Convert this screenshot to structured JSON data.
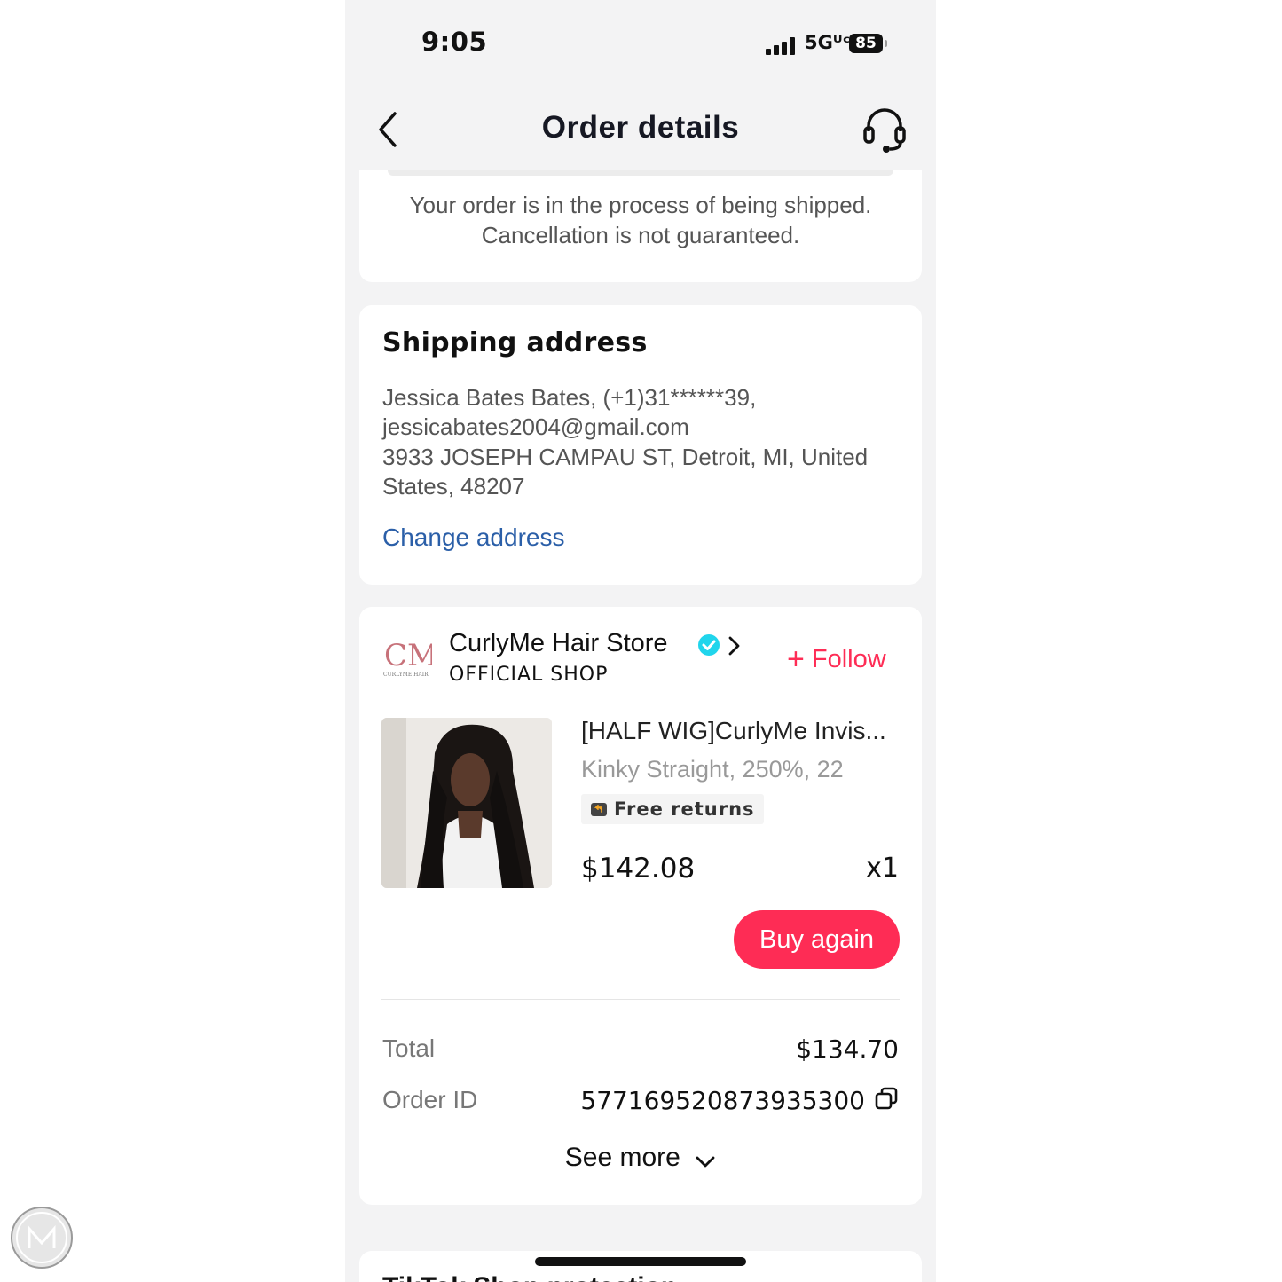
{
  "status_bar": {
    "time": "9:05",
    "network": "5Gᵁᶜ",
    "battery": "85"
  },
  "nav": {
    "title": "Order details",
    "back_icon": "chevron-left-icon",
    "support_icon": "headset-icon"
  },
  "shipping_notice": {
    "line1": "Your order is in the process of being shipped.",
    "line2": "Cancellation is not guaranteed."
  },
  "shipping_address": {
    "title": "Shipping address",
    "lines": [
      "Jessica Bates Bates, (+1)31******39,",
      "jessicabates2004@gmail.com",
      "3933 JOSEPH CAMPAU ST, Detroit, MI, United",
      "States, 48207"
    ],
    "change_label": "Change address"
  },
  "shop": {
    "name": "CurlyMe Hair Store",
    "tag": "OFFICIAL SHOP",
    "follow_label": "Follow",
    "logo_text": "CM",
    "logo_subtext": "CURLYME HAIR"
  },
  "product": {
    "title": "[HALF WIG]CurlyMe Invis...",
    "variant": "Kinky Straight, 250%, 22",
    "badge": "Free returns",
    "price": "$142.08",
    "quantity": "x1",
    "buy_again_label": "Buy again"
  },
  "summary": {
    "total_label": "Total",
    "total_value": "$134.70",
    "order_id_label": "Order ID",
    "order_id_value": "577169520873935300",
    "see_more_label": "See more"
  },
  "next_section": {
    "title": "TikTok Shop protection"
  },
  "colors": {
    "accent": "#fe2c55",
    "link": "#2b5fa8",
    "verified": "#20d5ec"
  }
}
